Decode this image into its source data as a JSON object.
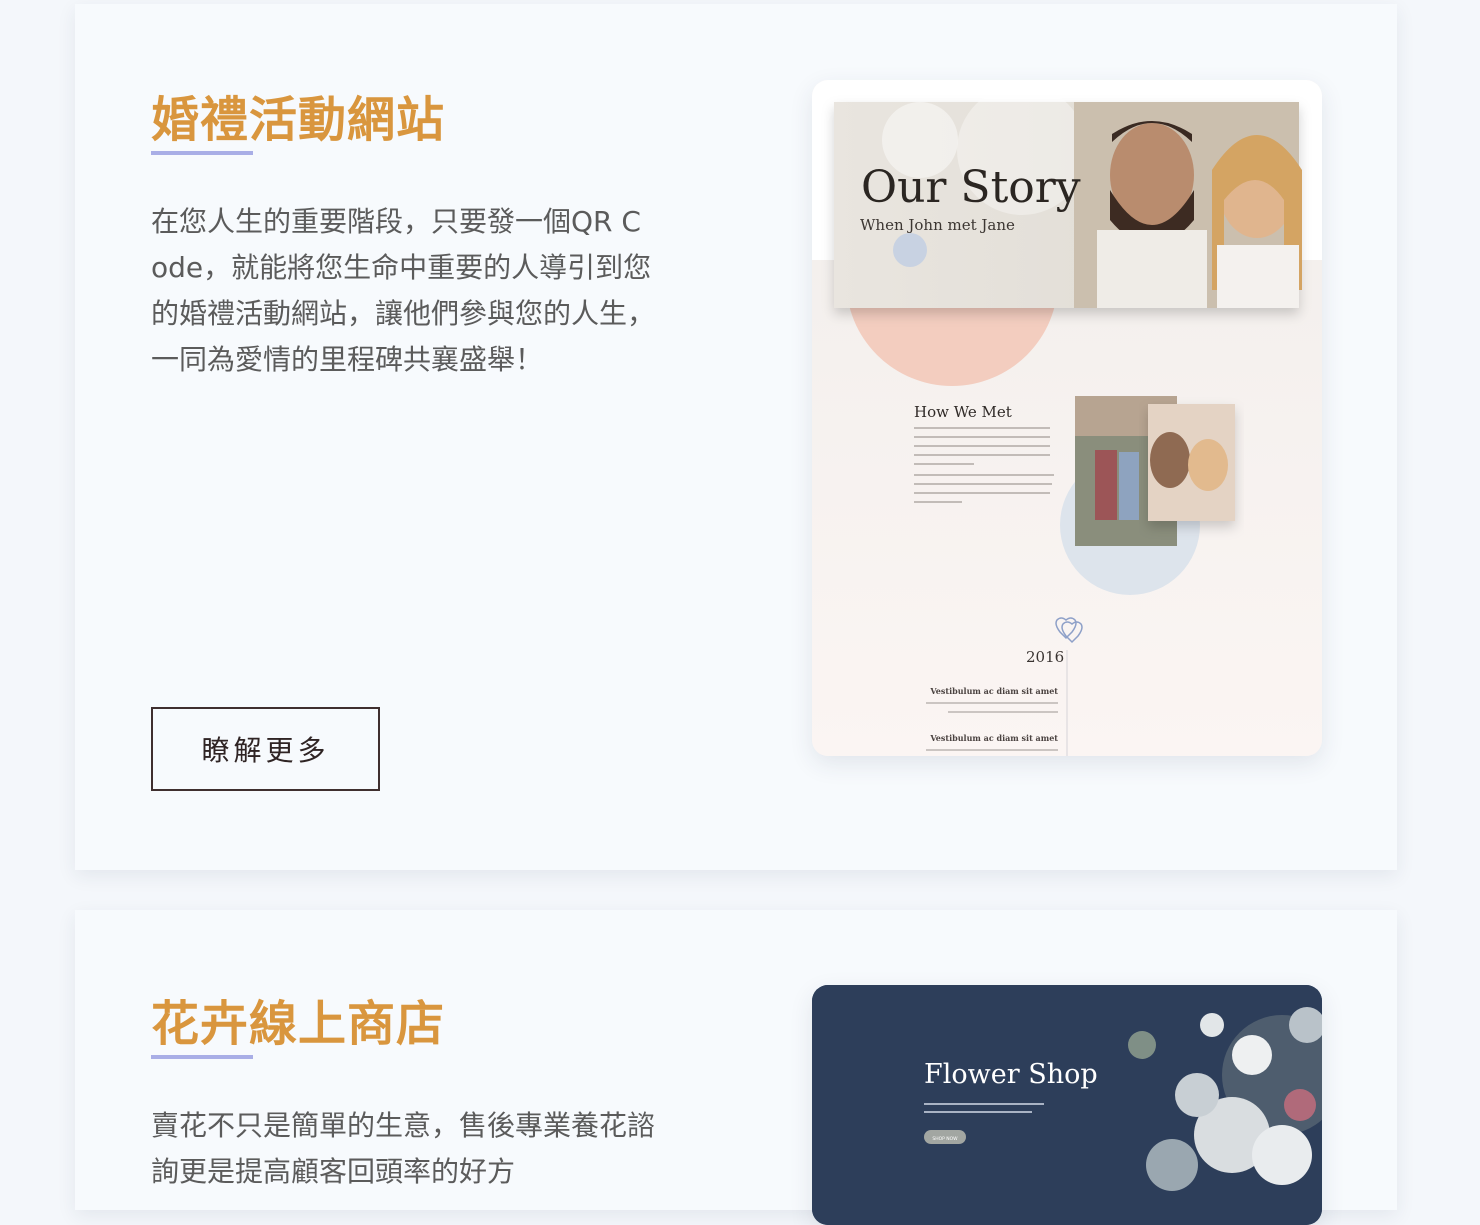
{
  "sections": [
    {
      "title": "婚禮活動網站",
      "description": "在您人生的重要階段，只要發一個QR Code，就能將您生命中重要的人導引到您的婚禮活動網站，讓他們參與您的人生，一同為愛情的里程碑共襄盛舉！",
      "button_label": "瞭解更多",
      "preview": {
        "hero_title": "Our Story",
        "hero_subtitle": "When John met Jane",
        "section_heading": "How We Met",
        "year": "2016",
        "timeline_item_1": "Vestibulum ac diam sit amet",
        "timeline_item_2": "Vestibulum ac diam sit amet"
      }
    },
    {
      "title": "花卉線上商店",
      "description": "賣花不只是簡單的生意，售後專業養花諮詢更是提高顧客回頭率的好方",
      "preview": {
        "hero_title": "Flower Shop",
        "shop_button": "SHOP NOW"
      }
    }
  ],
  "colors": {
    "accent_title": "#d9963e",
    "underline": "#a9aee6",
    "body_text": "#5b5b5b",
    "flower_bg": "#2d3e5a"
  }
}
